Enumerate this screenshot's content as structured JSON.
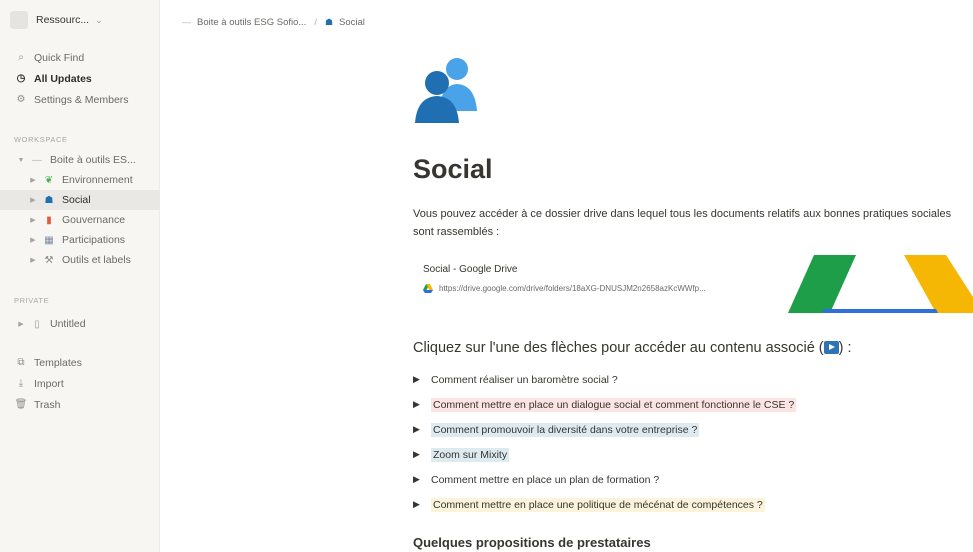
{
  "sidebar": {
    "workspace_name": "Ressourc...",
    "nav": {
      "quick_find": "Quick Find",
      "all_updates": "All Updates",
      "settings": "Settings & Members"
    },
    "workspace_label": "WORKSPACE",
    "tree": [
      {
        "label": "Boite à outils ES...",
        "icon": "page-icon"
      },
      {
        "label": "Environnement",
        "icon": "plant-icon"
      },
      {
        "label": "Social",
        "icon": "people-icon"
      },
      {
        "label": "Gouvernance",
        "icon": "building-icon"
      },
      {
        "label": "Participations",
        "icon": "chart-icon"
      },
      {
        "label": "Outils et labels",
        "icon": "tools-icon"
      }
    ],
    "private_label": "PRIVATE",
    "private_items": [
      {
        "label": "Untitled",
        "icon": "page-icon"
      }
    ],
    "bottom": {
      "templates": "Templates",
      "import": "Import",
      "trash": "Trash"
    }
  },
  "topbar": {
    "breadcrumb_1": "Boite à outils ESG Sofio...",
    "breadcrumb_2": "Social"
  },
  "page": {
    "icon": "people-icon",
    "title": "Social",
    "description": "Vous pouvez accéder à ce dossier drive dans lequel tous les documents relatifs aux bonnes pratiques sociales sont rassemblés :",
    "bookmark": {
      "title": "Social - Google Drive",
      "url": "https://drive.google.com/drive/folders/18aXG-DNUSJM2n2658azKcWWfp..."
    },
    "heading_1_before": "Cliquez sur l'une des flèches pour accéder au contenu associé (",
    "heading_1_after": ") :",
    "toggles": [
      {
        "label": "Comment réaliser un baromètre social ?",
        "highlight": "none"
      },
      {
        "label": "Comment mettre en place un dialogue social et comment fonctionne le CSE ?",
        "highlight": "red"
      },
      {
        "label": "Comment promouvoir la diversité dans votre entreprise ?",
        "highlight": "blue"
      },
      {
        "label": "Zoom sur Mixity",
        "highlight": "blue"
      },
      {
        "label": "Comment mettre en place un plan de formation ?",
        "highlight": "none"
      },
      {
        "label": "Comment mettre en place une politique de mécénat de compétences ?",
        "highlight": "yellow"
      }
    ],
    "heading_2": "Quelques propositions de prestataires"
  },
  "colors": {
    "sidebar_bg": "#f7f6f3",
    "icon_blue_dark": "#1f6fb2",
    "icon_blue_light": "#4aa3e8",
    "drive_green": "#1e9e48",
    "drive_yellow": "#f6b704",
    "drive_blue": "#2f6fdc"
  }
}
